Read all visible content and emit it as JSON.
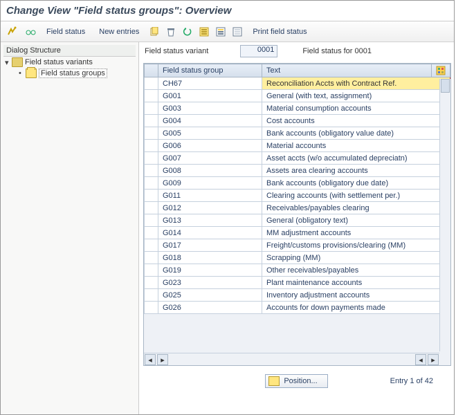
{
  "title": "Change View \"Field status groups\": Overview",
  "toolbar": {
    "field_status_label": "Field status",
    "new_entries_label": "New entries",
    "print_label": "Print field status"
  },
  "left": {
    "header": "Dialog Structure",
    "root": "Field status variants",
    "child": "Field status groups"
  },
  "header": {
    "variant_label": "Field status variant",
    "variant_value": "0001",
    "variant_for": "Field status for 0001"
  },
  "table": {
    "col_code": "Field status group",
    "col_text": "Text",
    "rows": [
      {
        "code": "CH67",
        "text": "Reconciliation Accts with Contract Ref."
      },
      {
        "code": "G001",
        "text": "General (with text, assignment)"
      },
      {
        "code": "G003",
        "text": "Material consumption accounts"
      },
      {
        "code": "G004",
        "text": "Cost accounts"
      },
      {
        "code": "G005",
        "text": "Bank accounts (obligatory value date)"
      },
      {
        "code": "G006",
        "text": "Material accounts"
      },
      {
        "code": "G007",
        "text": "Asset accts (w/o accumulated depreciatn)"
      },
      {
        "code": "G008",
        "text": "Assets area clearing accounts"
      },
      {
        "code": "G009",
        "text": "Bank accounts (obligatory due date)"
      },
      {
        "code": "G011",
        "text": "Clearing accounts (with settlement per.)"
      },
      {
        "code": "G012",
        "text": "Receivables/payables clearing"
      },
      {
        "code": "G013",
        "text": "General (obligatory text)"
      },
      {
        "code": "G014",
        "text": "MM adjustment accounts"
      },
      {
        "code": "G017",
        "text": "Freight/customs provisions/clearing (MM)"
      },
      {
        "code": "G018",
        "text": "Scrapping (MM)"
      },
      {
        "code": "G019",
        "text": "Other receivables/payables"
      },
      {
        "code": "G023",
        "text": "Plant maintenance accounts"
      },
      {
        "code": "G025",
        "text": "Inventory adjustment accounts"
      },
      {
        "code": "G026",
        "text": "Accounts for down payments made"
      }
    ]
  },
  "footer": {
    "position_label": "Position...",
    "entry_text": "Entry 1 of 42"
  },
  "icons": {
    "pencil": "pencil-icon",
    "glasses": "glasses-icon",
    "copy": "copy-icon",
    "delete": "delete-icon",
    "undo": "undo-icon",
    "sel_all": "select-all-icon",
    "sel_block": "select-block-icon",
    "desel": "deselect-icon",
    "print": "print-icon",
    "settings": "table-settings-icon"
  }
}
